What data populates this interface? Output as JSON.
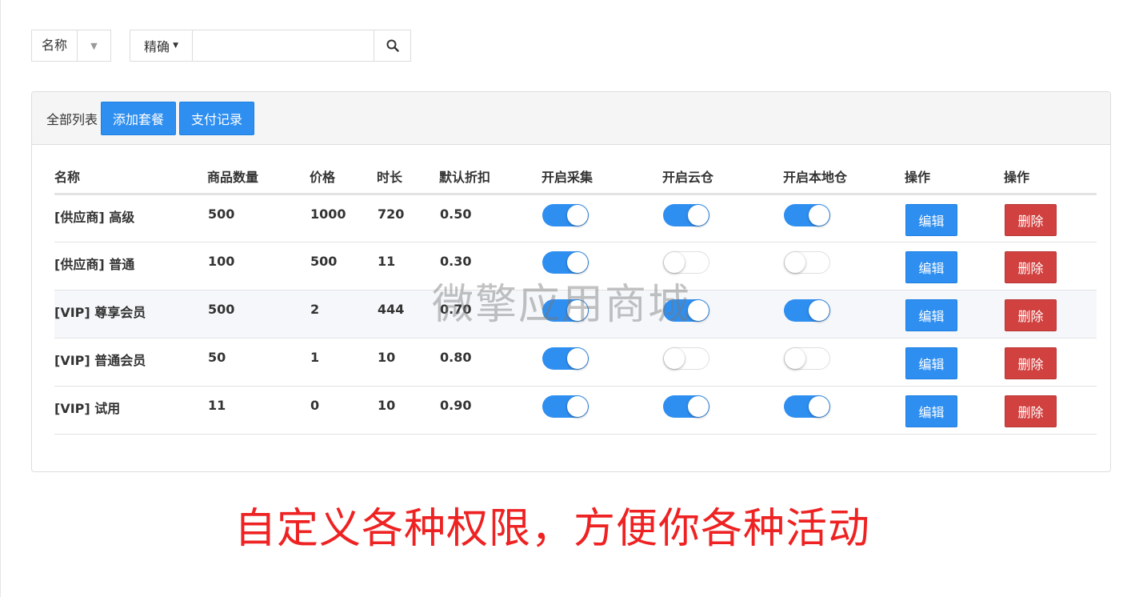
{
  "filter": {
    "field_label": "名称",
    "match_label": "精确",
    "search_value": "",
    "search_placeholder": ""
  },
  "panel": {
    "title": "全部列表",
    "add_button": "添加套餐",
    "pay_button": "支付记录"
  },
  "table": {
    "headers": [
      "名称",
      "商品数量",
      "价格",
      "时长",
      "默认折扣",
      "开启采集",
      "开启云仓",
      "开启本地仓",
      "操作",
      "操作"
    ],
    "rows": [
      {
        "name": "[供应商] 高级",
        "qty": "500",
        "price": "1000",
        "duration": "720",
        "discount": "0.50",
        "collect": true,
        "cloud": true,
        "local": true,
        "edit": "编辑",
        "delete": "删除"
      },
      {
        "name": "[供应商] 普通",
        "qty": "100",
        "price": "500",
        "duration": "11",
        "discount": "0.30",
        "collect": true,
        "cloud": false,
        "local": false,
        "edit": "编辑",
        "delete": "删除"
      },
      {
        "name": "[VIP] 尊享会员",
        "qty": "500",
        "price": "2",
        "duration": "444",
        "discount": "0.70",
        "collect": true,
        "cloud": true,
        "local": true,
        "edit": "编辑",
        "delete": "删除"
      },
      {
        "name": "[VIP] 普通会员",
        "qty": "50",
        "price": "1",
        "duration": "10",
        "discount": "0.80",
        "collect": true,
        "cloud": false,
        "local": false,
        "edit": "编辑",
        "delete": "删除"
      },
      {
        "name": "[VIP] 试用",
        "qty": "11",
        "price": "0",
        "duration": "10",
        "discount": "0.90",
        "collect": true,
        "cloud": true,
        "local": true,
        "edit": "编辑",
        "delete": "删除"
      }
    ]
  },
  "watermark": "微擎应用商城",
  "promo_text": "自定义各种权限，方便你各种活动",
  "colors": {
    "primary": "#2f8ff0",
    "danger": "#d0413f",
    "promo": "#ee2222"
  },
  "icons": {
    "search": "search-icon",
    "caret": "caret-down-icon"
  }
}
